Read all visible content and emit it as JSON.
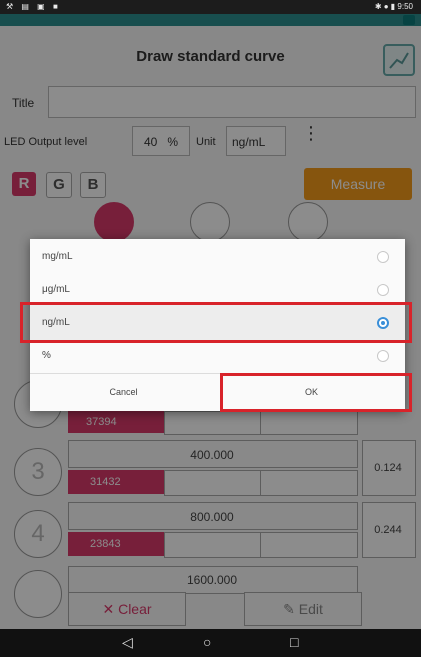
{
  "status_bar": {
    "left_icons": "⚒ ▤ ▣ ■",
    "right": "✱ ● ▮ 9:50"
  },
  "app_strip": {
    "text": ""
  },
  "screen": {
    "title": "Draw standard curve",
    "title_label": "Title",
    "led_label": "LED Output level",
    "led_value": "40",
    "led_unit": "%",
    "unit_label": "Unit",
    "unit_value": "ng/mL",
    "more_glyph": "⋮",
    "rgb": [
      "R",
      "G",
      "B"
    ],
    "measure_label": "Measure",
    "rows": [
      {
        "num": "",
        "conc": "",
        "raw": "37394",
        "abs": ""
      },
      {
        "num": "3",
        "conc": "400.000",
        "raw": "31432",
        "abs": "0.124"
      },
      {
        "num": "4",
        "conc": "800.000",
        "raw": "23843",
        "abs": "0.244"
      },
      {
        "num": "",
        "conc": "1600.000",
        "raw": "",
        "abs": ""
      }
    ],
    "clear_label": "Clear",
    "clear_glyph": "✕",
    "edit_label": "Edit",
    "edit_glyph": "✎"
  },
  "dialog": {
    "options": [
      {
        "label": "mg/mL",
        "selected": false
      },
      {
        "label": "μg/mL",
        "selected": false
      },
      {
        "label": "ng/mL",
        "selected": true
      },
      {
        "label": "%",
        "selected": false
      }
    ],
    "cancel_label": "Cancel",
    "ok_label": "OK"
  },
  "nav": {
    "back": "◁",
    "home": "○",
    "recents": "□"
  },
  "colors": {
    "accent_red": "#d9396b",
    "measure_orange": "#f59b1a",
    "highlight": "#d8232a",
    "radio_blue": "#3a8fd8"
  }
}
